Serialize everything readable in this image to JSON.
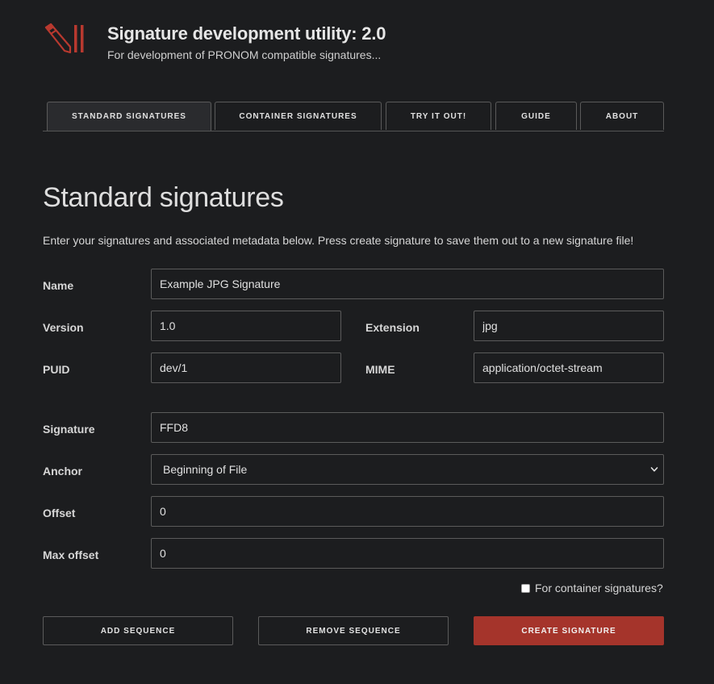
{
  "header": {
    "title": "Signature development utility: 2.0",
    "subtitle": "For development of PRONOM compatible signatures...",
    "logo_icon": "pencil-logo-icon",
    "accent_color": "#a5342b"
  },
  "tabs": [
    {
      "label": "Standard signatures",
      "active": true
    },
    {
      "label": "Container signatures",
      "active": false
    },
    {
      "label": "Try it out!",
      "active": false
    },
    {
      "label": "Guide",
      "active": false
    },
    {
      "label": "About",
      "active": false
    }
  ],
  "main": {
    "title": "Standard signatures",
    "intro": "Enter your signatures and associated metadata below. Press create signature to save them out to a new signature file!"
  },
  "form": {
    "name": {
      "label": "Name",
      "value": "Example JPG Signature"
    },
    "version": {
      "label": "Version",
      "value": "1.0"
    },
    "extension": {
      "label": "Extension",
      "value": "jpg"
    },
    "puid": {
      "label": "PUID",
      "value": "dev/1"
    },
    "mime": {
      "label": "MIME",
      "value": "application/octet-stream"
    },
    "signature": {
      "label": "Signature",
      "value": "FFD8"
    },
    "anchor": {
      "label": "Anchor",
      "value": "Beginning of File"
    },
    "offset": {
      "label": "Offset",
      "value": "0"
    },
    "max_offset": {
      "label": "Max offset",
      "value": "0"
    },
    "container_checkbox": {
      "label": "For container signatures?",
      "checked": false
    }
  },
  "buttons": {
    "add_sequence": "Add sequence",
    "remove_sequence": "Remove sequence",
    "create_signature": "Create signature"
  }
}
